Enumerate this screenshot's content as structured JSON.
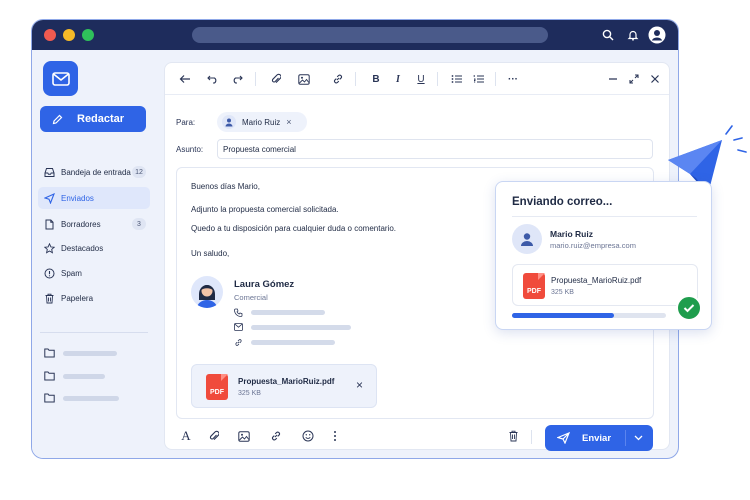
{
  "sidebar": {
    "compose_label": "Redactar",
    "items": [
      {
        "label": "Bandeja de entrada",
        "count": "12",
        "icon": "inbox-icon"
      },
      {
        "label": "Enviados",
        "count": "",
        "icon": "send-icon"
      },
      {
        "label": "Borradores",
        "count": "3",
        "icon": "draft-icon"
      },
      {
        "label": "Destacados",
        "count": "",
        "icon": "star-icon"
      },
      {
        "label": "Spam",
        "count": "",
        "icon": "alert-icon"
      },
      {
        "label": "Papelera",
        "count": "",
        "icon": "trash-icon"
      }
    ]
  },
  "compose": {
    "to_label": "Para:",
    "recipient": "Mario Ruiz",
    "subject_label": "Asunto:",
    "subject": "Propuesta comercial",
    "greeting": "Buenos días Mario,",
    "line1": "Adjunto la propuesta comercial solicitada.",
    "line2": "Quedo a tu disposición para cualquier duda o comentario.",
    "closing": "Un saludo,",
    "signature": {
      "name": "Laura Gómez",
      "role": "Comercial"
    },
    "attachment": {
      "name": "Propuesta_MarioRuiz.pdf",
      "size": "325 KB",
      "type": "PDF"
    },
    "send_label": "Enviar"
  },
  "popup": {
    "title": "Enviando correo...",
    "recipient_name": "Mario Ruiz",
    "recipient_email": "mario.ruiz@empresa.com",
    "file_name": "Propuesta_MarioRuiz.pdf",
    "file_size": "325 KB",
    "file_type": "PDF",
    "progress_percent": 66
  },
  "colors": {
    "accent": "#2f64e6",
    "titlebar": "#1e2c5c",
    "success": "#1f9d4d",
    "pdf": "#f04b3c"
  }
}
